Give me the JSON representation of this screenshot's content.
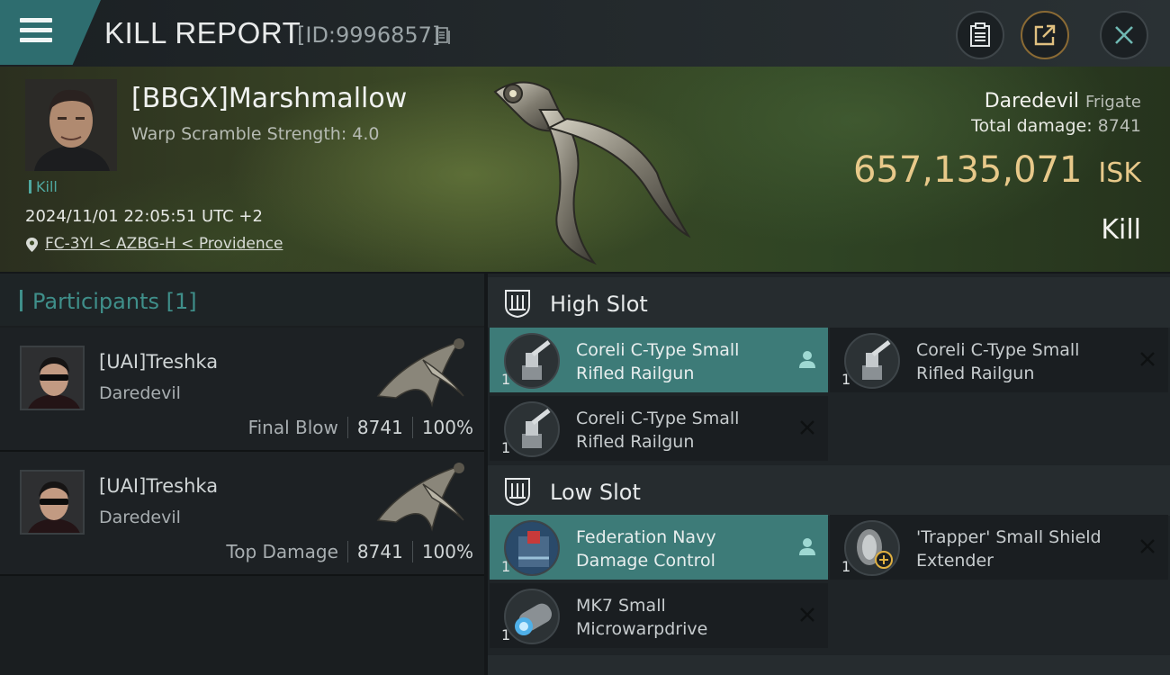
{
  "header": {
    "title": "KILL REPORT",
    "report_id": "[ID:9996857]"
  },
  "victim": {
    "pilot_name": "[BBGX]Marshmallow",
    "warp_scramble": "Warp Scramble Strength: 4.0",
    "tag": "Kill",
    "timestamp": "2024/11/01 22:05:51 UTC +2",
    "location": "FC-3YI < AZBG-H < Providence",
    "ship_name": "Daredevil",
    "ship_class": "Frigate",
    "total_damage_label": "Total damage:",
    "total_damage": "8741",
    "isk_value": "657,135,071",
    "isk_unit": "ISK",
    "result": "Kill"
  },
  "participants": {
    "title": "Participants [1]",
    "rows": [
      {
        "name": "[UAI]Treshka",
        "ship": "Daredevil",
        "role": "Final Blow",
        "damage": "8741",
        "percent": "100%"
      },
      {
        "name": "[UAI]Treshka",
        "ship": "Daredevil",
        "role": "Top Damage",
        "damage": "8741",
        "percent": "100%"
      }
    ]
  },
  "fitting": {
    "high_slot": {
      "title": "High Slot",
      "modules": [
        {
          "name_line1": "Coreli C-Type Small",
          "name_line2": "Rifled Railgun",
          "qty": "1",
          "status": "fitted"
        },
        {
          "name_line1": "Coreli C-Type Small",
          "name_line2": "Rifled Railgun",
          "qty": "1",
          "status": "destroyed"
        },
        {
          "name_line1": "Coreli C-Type Small",
          "name_line2": "Rifled Railgun",
          "qty": "1",
          "status": "destroyed"
        }
      ]
    },
    "low_slot": {
      "title": "Low Slot",
      "modules": [
        {
          "name_line1": "Federation Navy",
          "name_line2": "Damage Control",
          "qty": "1",
          "status": "fitted"
        },
        {
          "name_line1": "'Trapper' Small Shield",
          "name_line2": "Extender",
          "qty": "1",
          "status": "destroyed"
        },
        {
          "name_line1": "MK7 Small",
          "name_line2": "Microwarpdrive",
          "qty": "1",
          "status": "destroyed"
        }
      ]
    }
  },
  "colors": {
    "accent_teal": "#3d7b78",
    "isk_gold": "#e8c98a",
    "menu_teal": "#2e6d6f"
  },
  "icons": [
    "menu-icon",
    "copy-icon",
    "clipboard-icon",
    "share-icon",
    "close-icon",
    "location-pin-icon",
    "high-slot-icon",
    "low-slot-icon",
    "pilot-icon",
    "x-icon"
  ]
}
